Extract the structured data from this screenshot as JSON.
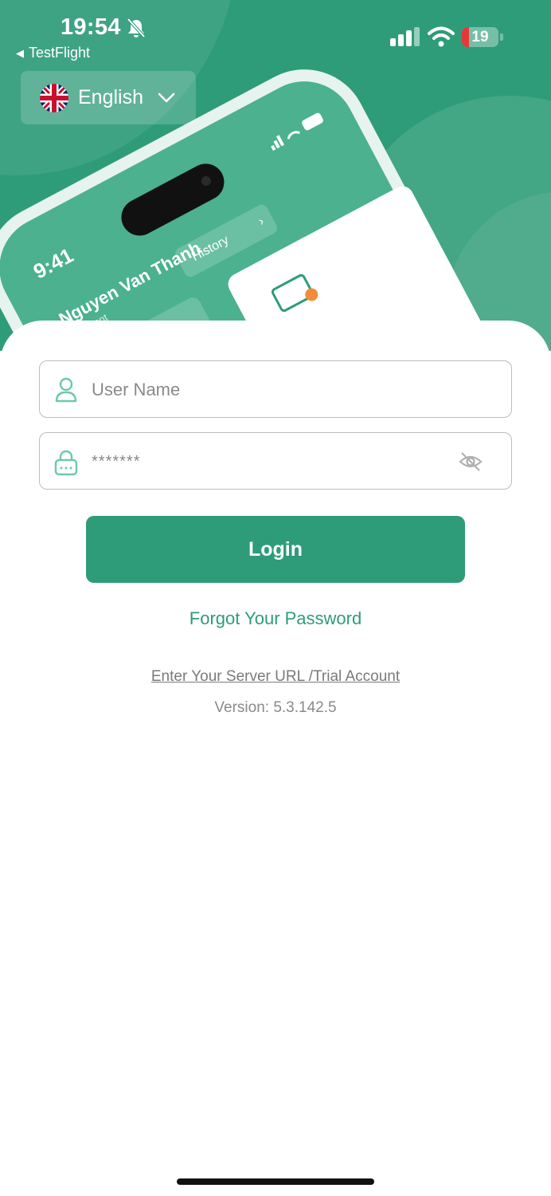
{
  "status_bar": {
    "time": "19:54",
    "back_app": "TestFlight",
    "battery": "19",
    "battery_level": 0.19,
    "icons": [
      "bell-slash-icon",
      "signal-icon",
      "wifi-icon",
      "battery-icon"
    ]
  },
  "language": {
    "label": "English",
    "flag": "uk-flag-icon"
  },
  "illustration": {
    "time": "9:41",
    "name": "Nguyen Van Thanh",
    "subtitle": "...opment",
    "history_label": "History"
  },
  "form": {
    "username_placeholder": "User Name",
    "password_value": "*******",
    "login_label": "Login",
    "forgot_label": "Forgot Your Password",
    "server_label": "Enter Your Server URL /Trial Account",
    "version_label": "Version: 5.3.142.5"
  },
  "colors": {
    "brand_green": "#2e9c78",
    "card_bg": "#ffffff",
    "border": "#bdbdbd",
    "icon_green": "#6cc9a8"
  }
}
